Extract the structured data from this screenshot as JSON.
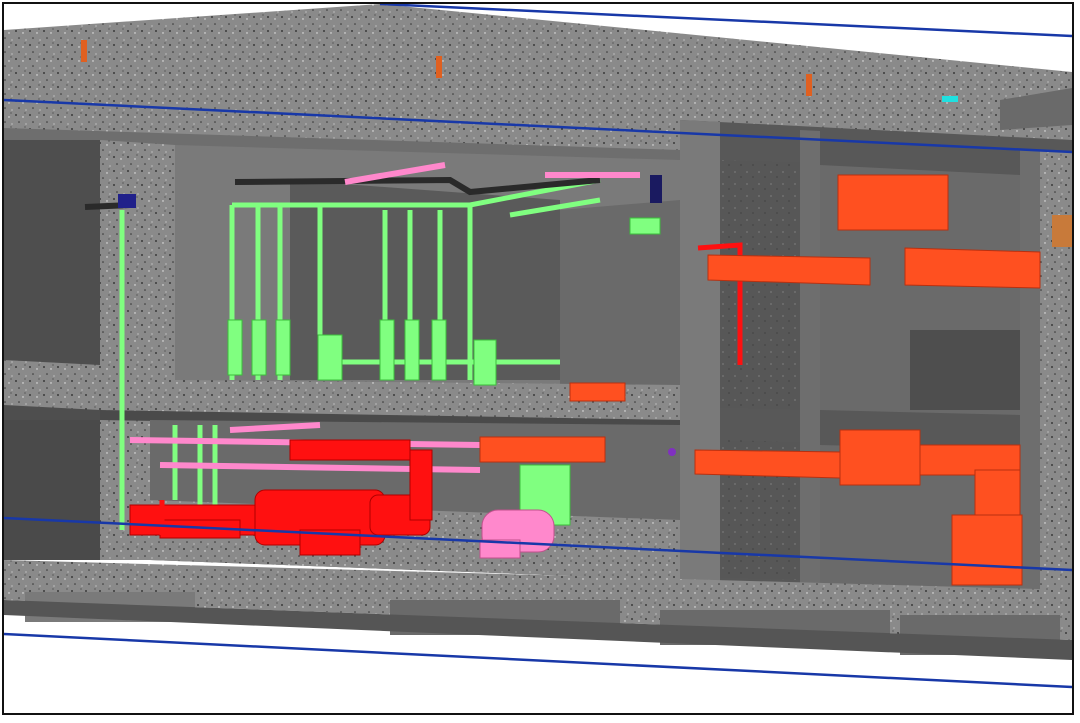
{
  "view": {
    "background": "#ffffff",
    "frame_color": "#111111",
    "concrete_color": "#8c8c8c",
    "concrete_dark": "#5a5a5a",
    "gridline_color": "#1838a8"
  },
  "systems": [
    {
      "name": "fire-protection-piping",
      "color": "#ff1010"
    },
    {
      "name": "water-supply-piping",
      "color": "#80ff80"
    },
    {
      "name": "drainage-piping",
      "color": "#ff88cc"
    },
    {
      "name": "hvac-ductwork",
      "color": "#ff5020"
    },
    {
      "name": "structural-concrete",
      "color": "#8c8c8c"
    }
  ]
}
